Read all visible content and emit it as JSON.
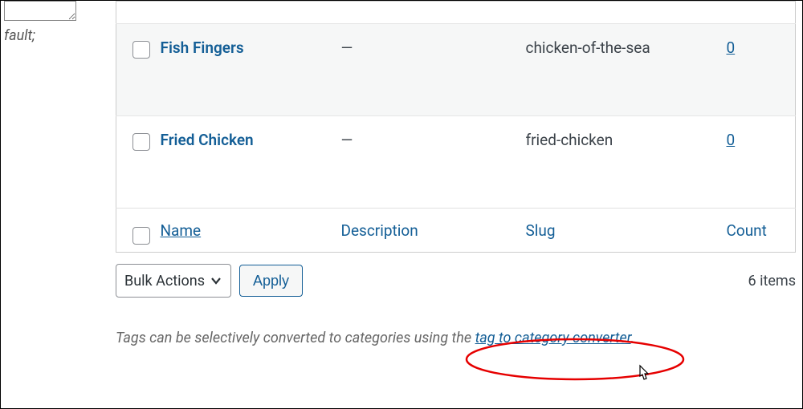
{
  "sidebar": {
    "fault_label": "fault;"
  },
  "table": {
    "rows": [
      {
        "name": "Fish Fingers",
        "description": "—",
        "slug": "chicken-of-the-sea",
        "count": "0"
      },
      {
        "name": "Fried Chicken",
        "description": "—",
        "slug": "fried-chicken",
        "count": "0"
      }
    ],
    "headers": {
      "name": "Name",
      "description": "Description",
      "slug": "Slug",
      "count": "Count"
    }
  },
  "actions": {
    "bulk_label": "Bulk Actions",
    "apply": "Apply",
    "items": "6 items"
  },
  "note": {
    "prefix": "Tags can be selectively converted to categories using the ",
    "link": "tag to category converter",
    "suffix": "."
  }
}
